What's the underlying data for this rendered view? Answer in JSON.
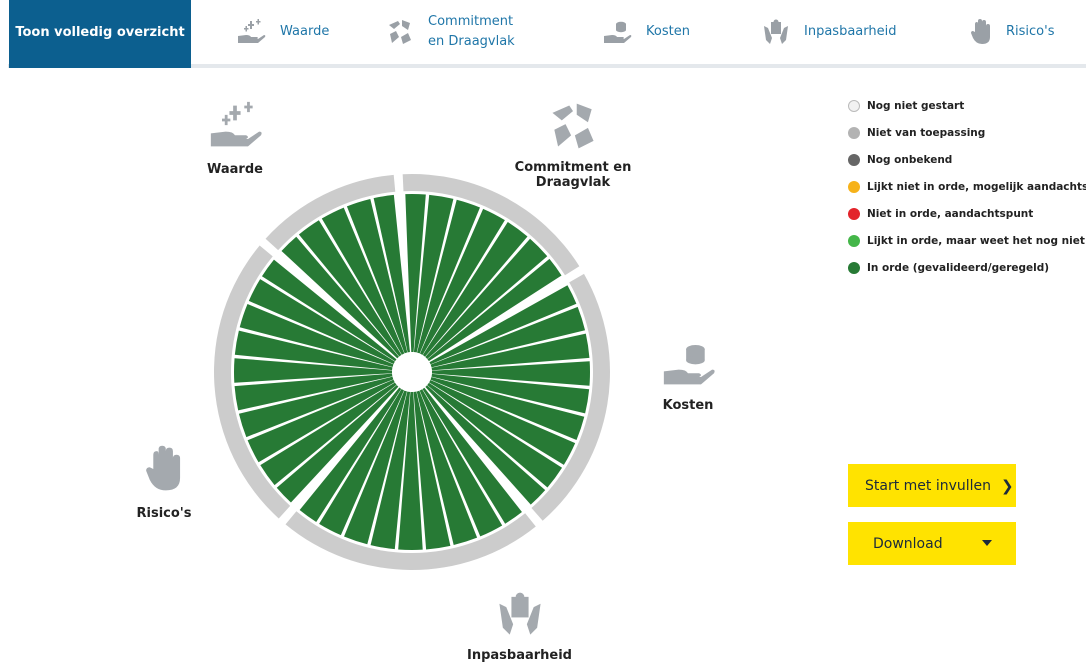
{
  "tabs": {
    "overview_label": "Toon volledig overzicht",
    "items": [
      {
        "label": "Waarde",
        "icon": "hand-plus-icon"
      },
      {
        "label": "Commitment en Draagvlak",
        "icon": "hands-together-icon"
      },
      {
        "label": "Kosten",
        "icon": "hand-coins-icon"
      },
      {
        "label": "Inpasbaarheid",
        "icon": "hands-puzzle-icon"
      },
      {
        "label": "Risico's",
        "icon": "hand-stop-icon"
      }
    ]
  },
  "categories": {
    "waarde": "Waarde",
    "commitment": "Commitment en Draagvlak",
    "kosten": "Kosten",
    "inpasbaarheid": "Inpasbaarheid",
    "risicos": "Risico's"
  },
  "legend": [
    {
      "label": "Nog niet gestart",
      "color": "#f2f2f2",
      "border": "#bbbbbb"
    },
    {
      "label": "Niet van toepassing",
      "color": "#b3b3b3"
    },
    {
      "label": "Nog onbekend",
      "color": "#666666"
    },
    {
      "label": "Lijkt niet in orde, mogelijk aandachtspunt",
      "color": "#f6b21a"
    },
    {
      "label": "Niet in orde, aandachtspunt",
      "color": "#e3242b"
    },
    {
      "label": "Lijkt in orde, maar weet het nog niet zeker",
      "color": "#44b649"
    },
    {
      "label": "In orde (gevalideerd/geregeld)",
      "color": "#277a35"
    }
  ],
  "wheel": {
    "segment_status_color": "#277a35",
    "ring_color": "#cccccc",
    "groups": [
      {
        "name": "Commitment en Draagvlak",
        "segments": 7
      },
      {
        "name": "Kosten",
        "segments": 9
      },
      {
        "name": "Inpasbaarheid",
        "segments": 9
      },
      {
        "name": "Risico's",
        "segments": 10
      },
      {
        "name": "Waarde",
        "segments": 5
      }
    ]
  },
  "buttons": {
    "start_label": "Start met invullen",
    "start_icon": "chevron-right-icon",
    "download_label": "Download",
    "download_icon": "caret-down-icon"
  }
}
